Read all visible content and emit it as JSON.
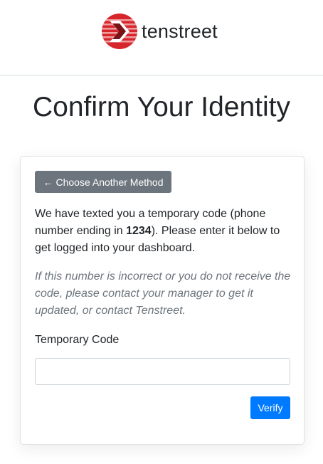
{
  "header": {
    "logo_text": "tenstreet",
    "logo_colors": {
      "red": "#d7262b",
      "dark": "#7a1216"
    }
  },
  "page": {
    "title": "Confirm Your Identity"
  },
  "card": {
    "back_button": {
      "icon": "arrow-left-icon",
      "label": "Choose Another Method"
    },
    "message": {
      "before": "We have texted you a temporary code (phone number ending in ",
      "phone_last_digits": "1234",
      "after": "). Please enter it below to get logged into your dashboard."
    },
    "note": "If this number is incorrect or you do not receive the code, please contact your manager to get it updated, or contact Tenstreet.",
    "code_field": {
      "label": "Temporary Code",
      "value": "",
      "placeholder": ""
    },
    "verify_button": {
      "label": "Verify"
    }
  },
  "colors": {
    "primary": "#007bff",
    "secondary": "#6c757d",
    "text": "#212529",
    "muted": "#6c757d"
  }
}
